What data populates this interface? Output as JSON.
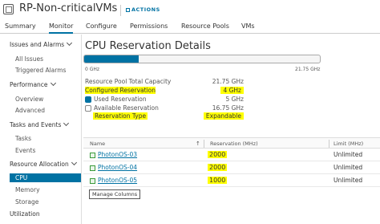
{
  "header": {
    "title": "RP-Non-criticalVMs",
    "actions_label": "ACTIONS"
  },
  "tabs": [
    "Summary",
    "Monitor",
    "Configure",
    "Permissions",
    "Resource Pools",
    "VMs"
  ],
  "active_tab": "Monitor",
  "sidebar": {
    "sections": [
      {
        "label": "Issues and Alarms",
        "items": [
          "All Issues",
          "Triggered Alarms"
        ]
      },
      {
        "label": "Performance",
        "items": [
          "Overview",
          "Advanced"
        ]
      },
      {
        "label": "Tasks and Events",
        "items": [
          "Tasks",
          "Events"
        ]
      },
      {
        "label": "Resource Allocation",
        "items": [
          "CPU",
          "Memory",
          "Storage"
        ]
      }
    ],
    "extra_item": "Utilization",
    "active_item": "CPU"
  },
  "main": {
    "title": "CPU Reservation Details",
    "bar": {
      "min_label": "0 GHz",
      "max_label": "21.75 GHz",
      "fill_fraction": 0.23
    },
    "stats": {
      "total_capacity": {
        "label": "Resource Pool Total Capacity",
        "value": "21.75 GHz"
      },
      "configured_reservation": {
        "label": "Configured Reservation",
        "value": "4 GHz"
      },
      "used_reservation": {
        "label": "Used Reservation",
        "value": "5 GHz"
      },
      "available_reservation": {
        "label": "Available Reservation",
        "value": "16.75 GHz"
      },
      "reservation_type": {
        "label": "Reservation Type",
        "value": "Expandable"
      }
    },
    "colors": {
      "accent": "#0072a3",
      "highlight": "#ffff00"
    },
    "grid": {
      "columns": [
        "Name",
        "Reservation (MHz)",
        "Limit (MHz)"
      ],
      "rows": [
        {
          "name": "PhotonOS-03",
          "reservation": "2000",
          "limit": "Unlimited"
        },
        {
          "name": "PhotonOS-04",
          "reservation": "2000",
          "limit": "Unlimited"
        },
        {
          "name": "PhotonOS-05",
          "reservation": "1000",
          "limit": "Unlimited"
        }
      ],
      "manage_columns_label": "Manage Columns"
    }
  }
}
